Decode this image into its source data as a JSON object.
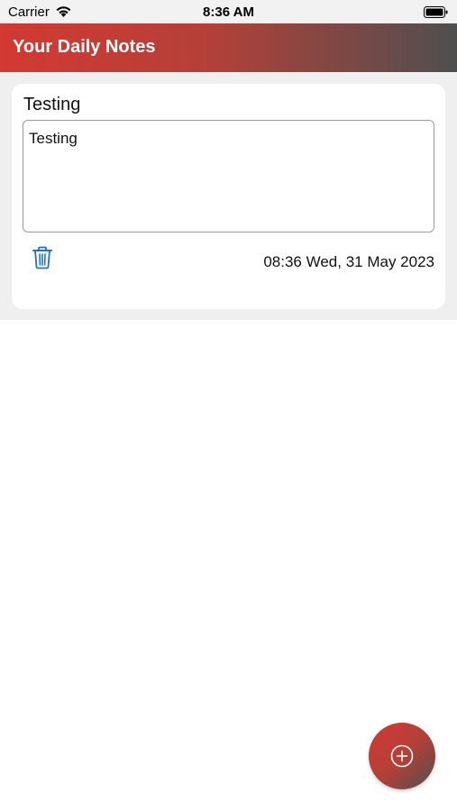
{
  "status_bar": {
    "carrier": "Carrier",
    "time": "8:36 AM",
    "wifi_icon": "wifi-icon",
    "battery_icon": "battery-full-icon"
  },
  "header": {
    "title": "Your Daily Notes",
    "gradient_start": "#d23a32",
    "gradient_end": "#4f4f4f"
  },
  "notes": [
    {
      "title": "Testing",
      "body": "Testing",
      "timestamp": "08:36 Wed, 31 May 2023",
      "delete_icon": "trash-icon"
    }
  ],
  "fab": {
    "icon": "plus-circle-icon"
  },
  "colors": {
    "accent_red": "#d23a32",
    "accent_gray": "#4f4f4f",
    "delete_blue": "#1e6fd9",
    "list_background": "#efefef"
  }
}
